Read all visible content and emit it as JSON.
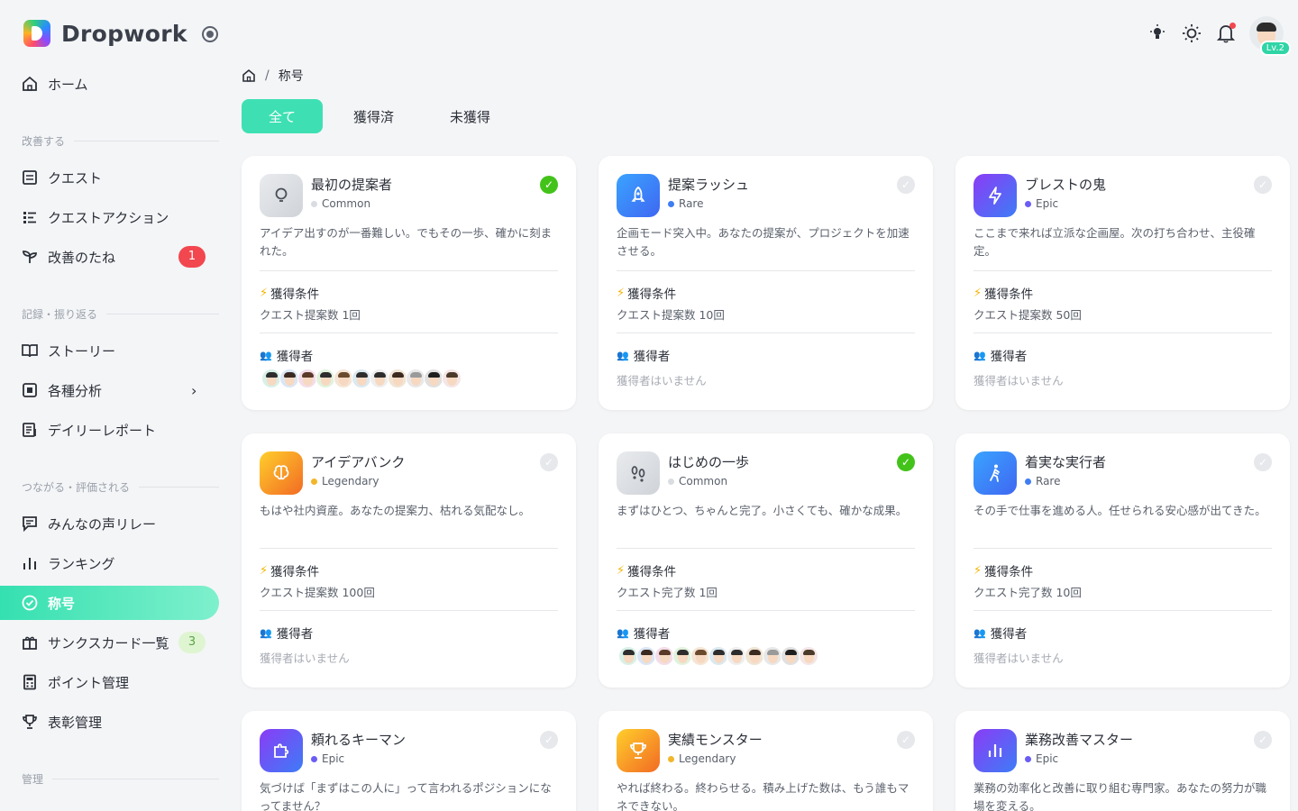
{
  "app": {
    "name": "Dropwork"
  },
  "user": {
    "level": "Lv.2"
  },
  "sidebar": {
    "home": "ホーム",
    "sections": [
      {
        "label": "改善する"
      },
      {
        "label": "記録・振り返る"
      },
      {
        "label": "つながる・評価される"
      },
      {
        "label": "管理"
      }
    ],
    "items": [
      {
        "label": "クエスト"
      },
      {
        "label": "クエストアクション"
      },
      {
        "label": "改善のたね",
        "badge": "1"
      },
      {
        "label": "ストーリー"
      },
      {
        "label": "各種分析"
      },
      {
        "label": "デイリーレポート"
      },
      {
        "label": "みんなの声リレー"
      },
      {
        "label": "ランキング"
      },
      {
        "label": "称号"
      },
      {
        "label": "サンクスカード一覧",
        "badge": "3"
      },
      {
        "label": "ポイント管理"
      },
      {
        "label": "表彰管理"
      }
    ]
  },
  "breadcrumb": {
    "current": "称号",
    "separator": "/"
  },
  "tabs": [
    {
      "label": "全て"
    },
    {
      "label": "獲得済"
    },
    {
      "label": "未獲得"
    }
  ],
  "labels": {
    "condition": "獲得条件",
    "holders": "獲得者",
    "no_holders": "獲得者はいません"
  },
  "colors": {
    "accent": "#3ee0b3",
    "common": "#d9dce0",
    "rare": "#3f7df2",
    "epic": "#6a5cf5",
    "legendary": "#f1b62a",
    "earned": "#43c31a"
  },
  "cards": [
    {
      "title": "最初の提案者",
      "rarity": "Common",
      "icon": "lightbulb-icon",
      "earned": true,
      "desc": "アイデア出すのが一番難しい。でもその一歩、確かに刻まれた。",
      "condition": "クエスト提案数 1回",
      "holders": 11
    },
    {
      "title": "提案ラッシュ",
      "rarity": "Rare",
      "icon": "rocket-icon",
      "earned": false,
      "desc": "企画モード突入中。あなたの提案が、プロジェクトを加速させる。",
      "condition": "クエスト提案数 10回",
      "holders": 0
    },
    {
      "title": "ブレストの鬼",
      "rarity": "Epic",
      "icon": "lightning-icon",
      "earned": false,
      "desc": "ここまで来れば立派な企画屋。次の打ち合わせ、主役確定。",
      "condition": "クエスト提案数 50回",
      "holders": 0
    },
    {
      "title": "アイデアバンク",
      "rarity": "Legendary",
      "icon": "brain-icon",
      "earned": false,
      "desc": "もはや社内資産。あなたの提案力、枯れる気配なし。",
      "condition": "クエスト提案数 100回",
      "holders": 0
    },
    {
      "title": "はじめの一歩",
      "rarity": "Common",
      "icon": "footprints-icon",
      "earned": true,
      "desc": "まずはひとつ、ちゃんと完了。小さくても、確かな成果。",
      "condition": "クエスト完了数 1回",
      "holders": 11
    },
    {
      "title": "着実な実行者",
      "rarity": "Rare",
      "icon": "walking-icon",
      "earned": false,
      "desc": "その手で仕事を進める人。任せられる安心感が出てきた。",
      "condition": "クエスト完了数 10回",
      "holders": 0
    },
    {
      "title": "頼れるキーマン",
      "rarity": "Epic",
      "icon": "puzzle-icon",
      "earned": false,
      "desc": "気づけば「まずはこの人に」って言われるポジションになってません？"
    },
    {
      "title": "実績モンスター",
      "rarity": "Legendary",
      "icon": "trophy-icon",
      "earned": false,
      "desc": "やれば終わる。終わらせる。積み上げた数は、もう誰もマネできない。"
    },
    {
      "title": "業務改善マスター",
      "rarity": "Epic",
      "icon": "chart-icon",
      "earned": false,
      "desc": "業務の効率化と改善に取り組む専門家。あなたの努力が職場を変える。"
    }
  ]
}
